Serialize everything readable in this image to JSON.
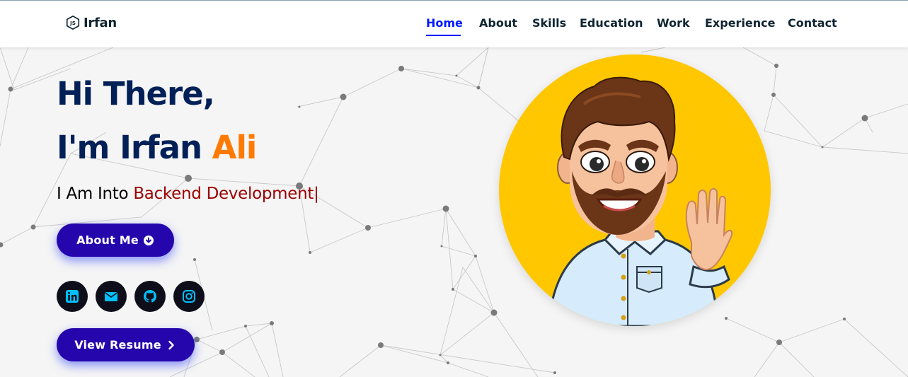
{
  "brand": {
    "name": "Irfan",
    "logo_icon": "nodejs-icon"
  },
  "nav": {
    "items": [
      {
        "label": "Home",
        "active": true
      },
      {
        "label": "About",
        "active": false
      },
      {
        "label": "Skills",
        "active": false
      },
      {
        "label": "Education",
        "active": false
      },
      {
        "label": "Work",
        "active": false
      },
      {
        "label": "Experience",
        "active": false
      },
      {
        "label": "Contact",
        "active": false
      }
    ]
  },
  "hero": {
    "line1": "Hi There,",
    "line2_prefix": "I'm Irfan ",
    "line2_accent": "Ali",
    "typed_prefix": "I Am Into ",
    "typed_role": "Backend Development",
    "typed_cursor": "|",
    "about_button": "About Me",
    "resume_button": "View Resume"
  },
  "socials": [
    {
      "name": "linkedin-icon"
    },
    {
      "name": "mail-icon"
    },
    {
      "name": "github-icon"
    },
    {
      "name": "instagram-icon"
    }
  ],
  "colors": {
    "primary_text": "#002057",
    "accent": "#ff7a00",
    "role": "#9b0000",
    "button": "#2506ad",
    "nav_active": "#011aff",
    "avatar_bg": "#ffc700",
    "social_bg": "#0e0e1a",
    "social_icon": "#00bfff"
  }
}
